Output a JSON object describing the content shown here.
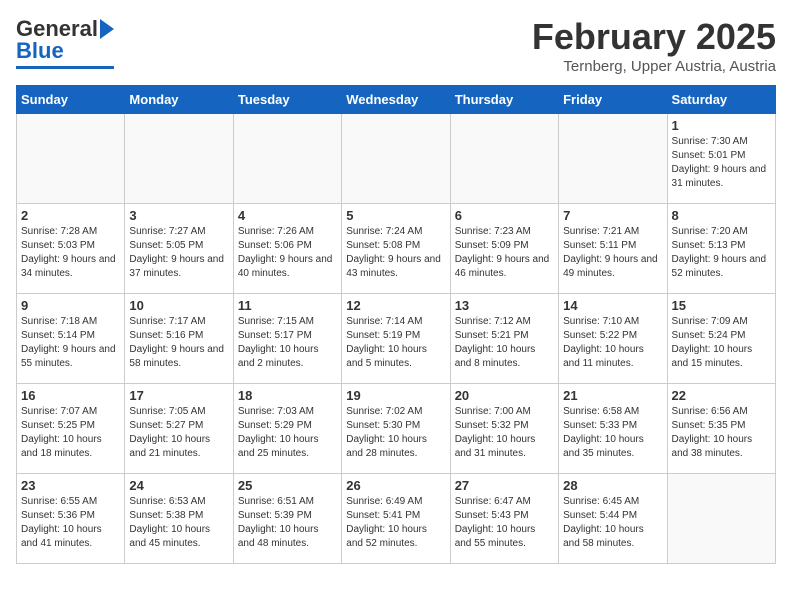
{
  "header": {
    "logo_general": "General",
    "logo_blue": "Blue",
    "month_year": "February 2025",
    "location": "Ternberg, Upper Austria, Austria"
  },
  "days_of_week": [
    "Sunday",
    "Monday",
    "Tuesday",
    "Wednesday",
    "Thursday",
    "Friday",
    "Saturday"
  ],
  "weeks": [
    [
      {
        "day": "",
        "info": ""
      },
      {
        "day": "",
        "info": ""
      },
      {
        "day": "",
        "info": ""
      },
      {
        "day": "",
        "info": ""
      },
      {
        "day": "",
        "info": ""
      },
      {
        "day": "",
        "info": ""
      },
      {
        "day": "1",
        "info": "Sunrise: 7:30 AM\nSunset: 5:01 PM\nDaylight: 9 hours and 31 minutes."
      }
    ],
    [
      {
        "day": "2",
        "info": "Sunrise: 7:28 AM\nSunset: 5:03 PM\nDaylight: 9 hours and 34 minutes."
      },
      {
        "day": "3",
        "info": "Sunrise: 7:27 AM\nSunset: 5:05 PM\nDaylight: 9 hours and 37 minutes."
      },
      {
        "day": "4",
        "info": "Sunrise: 7:26 AM\nSunset: 5:06 PM\nDaylight: 9 hours and 40 minutes."
      },
      {
        "day": "5",
        "info": "Sunrise: 7:24 AM\nSunset: 5:08 PM\nDaylight: 9 hours and 43 minutes."
      },
      {
        "day": "6",
        "info": "Sunrise: 7:23 AM\nSunset: 5:09 PM\nDaylight: 9 hours and 46 minutes."
      },
      {
        "day": "7",
        "info": "Sunrise: 7:21 AM\nSunset: 5:11 PM\nDaylight: 9 hours and 49 minutes."
      },
      {
        "day": "8",
        "info": "Sunrise: 7:20 AM\nSunset: 5:13 PM\nDaylight: 9 hours and 52 minutes."
      }
    ],
    [
      {
        "day": "9",
        "info": "Sunrise: 7:18 AM\nSunset: 5:14 PM\nDaylight: 9 hours and 55 minutes."
      },
      {
        "day": "10",
        "info": "Sunrise: 7:17 AM\nSunset: 5:16 PM\nDaylight: 9 hours and 58 minutes."
      },
      {
        "day": "11",
        "info": "Sunrise: 7:15 AM\nSunset: 5:17 PM\nDaylight: 10 hours and 2 minutes."
      },
      {
        "day": "12",
        "info": "Sunrise: 7:14 AM\nSunset: 5:19 PM\nDaylight: 10 hours and 5 minutes."
      },
      {
        "day": "13",
        "info": "Sunrise: 7:12 AM\nSunset: 5:21 PM\nDaylight: 10 hours and 8 minutes."
      },
      {
        "day": "14",
        "info": "Sunrise: 7:10 AM\nSunset: 5:22 PM\nDaylight: 10 hours and 11 minutes."
      },
      {
        "day": "15",
        "info": "Sunrise: 7:09 AM\nSunset: 5:24 PM\nDaylight: 10 hours and 15 minutes."
      }
    ],
    [
      {
        "day": "16",
        "info": "Sunrise: 7:07 AM\nSunset: 5:25 PM\nDaylight: 10 hours and 18 minutes."
      },
      {
        "day": "17",
        "info": "Sunrise: 7:05 AM\nSunset: 5:27 PM\nDaylight: 10 hours and 21 minutes."
      },
      {
        "day": "18",
        "info": "Sunrise: 7:03 AM\nSunset: 5:29 PM\nDaylight: 10 hours and 25 minutes."
      },
      {
        "day": "19",
        "info": "Sunrise: 7:02 AM\nSunset: 5:30 PM\nDaylight: 10 hours and 28 minutes."
      },
      {
        "day": "20",
        "info": "Sunrise: 7:00 AM\nSunset: 5:32 PM\nDaylight: 10 hours and 31 minutes."
      },
      {
        "day": "21",
        "info": "Sunrise: 6:58 AM\nSunset: 5:33 PM\nDaylight: 10 hours and 35 minutes."
      },
      {
        "day": "22",
        "info": "Sunrise: 6:56 AM\nSunset: 5:35 PM\nDaylight: 10 hours and 38 minutes."
      }
    ],
    [
      {
        "day": "23",
        "info": "Sunrise: 6:55 AM\nSunset: 5:36 PM\nDaylight: 10 hours and 41 minutes."
      },
      {
        "day": "24",
        "info": "Sunrise: 6:53 AM\nSunset: 5:38 PM\nDaylight: 10 hours and 45 minutes."
      },
      {
        "day": "25",
        "info": "Sunrise: 6:51 AM\nSunset: 5:39 PM\nDaylight: 10 hours and 48 minutes."
      },
      {
        "day": "26",
        "info": "Sunrise: 6:49 AM\nSunset: 5:41 PM\nDaylight: 10 hours and 52 minutes."
      },
      {
        "day": "27",
        "info": "Sunrise: 6:47 AM\nSunset: 5:43 PM\nDaylight: 10 hours and 55 minutes."
      },
      {
        "day": "28",
        "info": "Sunrise: 6:45 AM\nSunset: 5:44 PM\nDaylight: 10 hours and 58 minutes."
      },
      {
        "day": "",
        "info": ""
      }
    ]
  ]
}
